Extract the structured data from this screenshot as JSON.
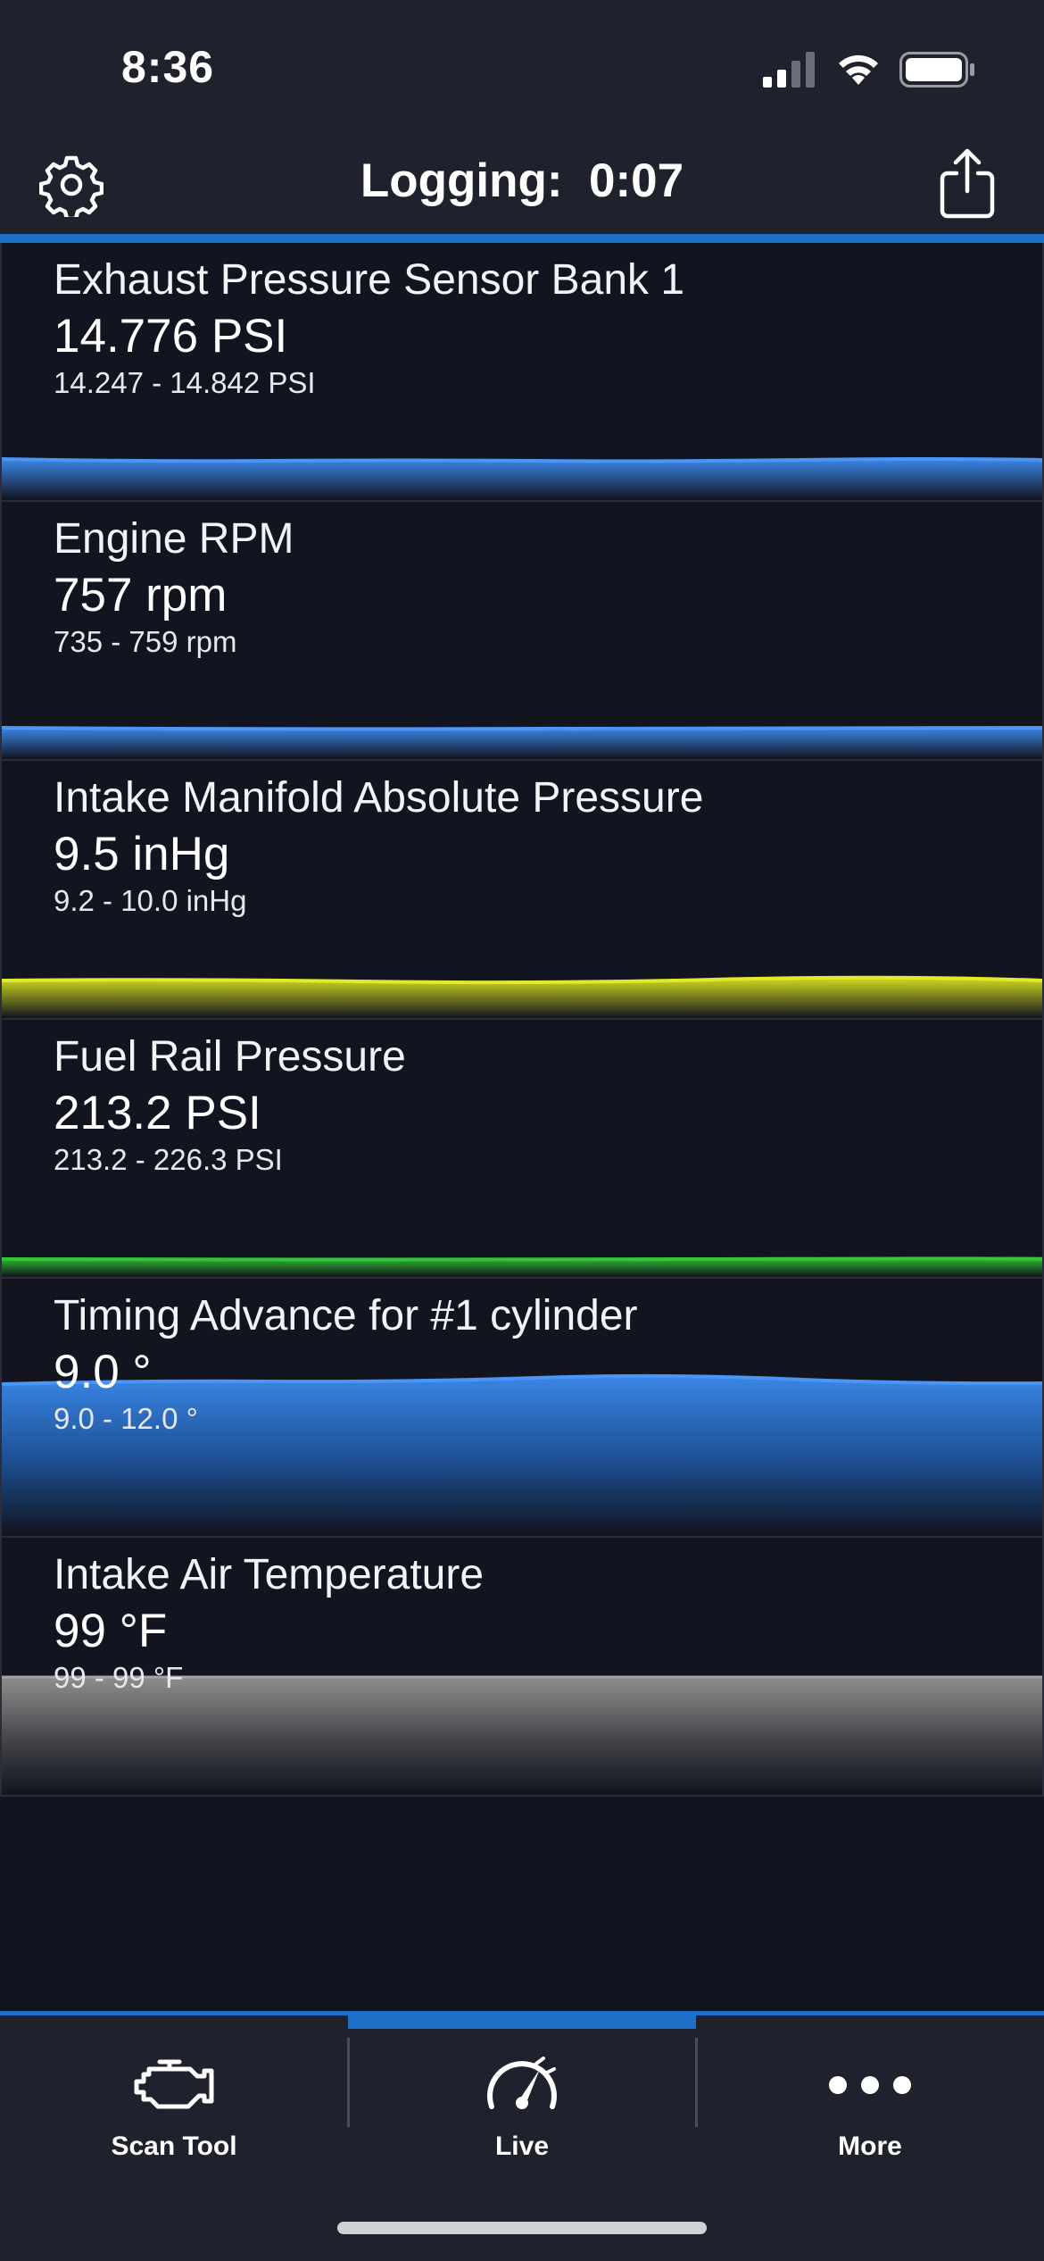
{
  "status_bar": {
    "time": "8:36"
  },
  "header": {
    "title": "Logging:  0:07"
  },
  "colors": {
    "accent": "#1f6fc9",
    "blue_trace": "#2e7be0",
    "yellow_trace": "#d2dc1e",
    "green_trace": "#2bb52f",
    "gray_trace": "#8a8a8a",
    "background": "#12141f",
    "header_bg": "#1f222c"
  },
  "gauges": [
    {
      "name": "Exhaust Pressure Sensor Bank 1",
      "value": "14.776 PSI",
      "range": "14.247 - 14.842 PSI",
      "color": "blue"
    },
    {
      "name": "Engine RPM",
      "value": "757 rpm",
      "range": "735 - 759 rpm",
      "color": "blue"
    },
    {
      "name": "Intake Manifold Absolute Pressure",
      "value": "9.5 inHg",
      "range": "9.2 - 10.0 inHg",
      "color": "yellow"
    },
    {
      "name": "Fuel Rail Pressure",
      "value": "213.2 PSI",
      "range": "213.2 - 226.3 PSI",
      "color": "green"
    },
    {
      "name": "Timing Advance for #1 cylinder",
      "value": "9.0 °",
      "range": "9.0 - 12.0 °",
      "color": "blue"
    },
    {
      "name": "Intake Air Temperature",
      "value": "99 °F",
      "range": "99 - 99 °F",
      "color": "gray"
    }
  ],
  "tabs": [
    {
      "label": "Scan Tool",
      "icon": "engine-icon",
      "active": false
    },
    {
      "label": "Live",
      "icon": "gauge-icon",
      "active": true
    },
    {
      "label": "More",
      "icon": "more-dots-icon",
      "active": false
    }
  ]
}
